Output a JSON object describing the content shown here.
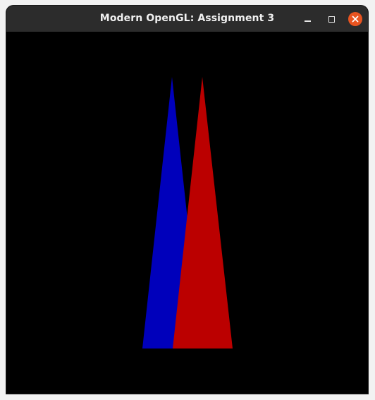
{
  "window": {
    "title": "Modern OpenGL: Assignment 3",
    "controls": [
      {
        "name": "minimize",
        "icon": "minimize-icon"
      },
      {
        "name": "maximize",
        "icon": "maximize-icon"
      },
      {
        "name": "close",
        "icon": "close-icon"
      }
    ],
    "close_color": "#e95420"
  },
  "scene": {
    "background": "#000000",
    "triangles": [
      {
        "name": "blue-triangle",
        "color": "#0000bb"
      },
      {
        "name": "red-triangle",
        "color": "#bb0000"
      }
    ]
  }
}
